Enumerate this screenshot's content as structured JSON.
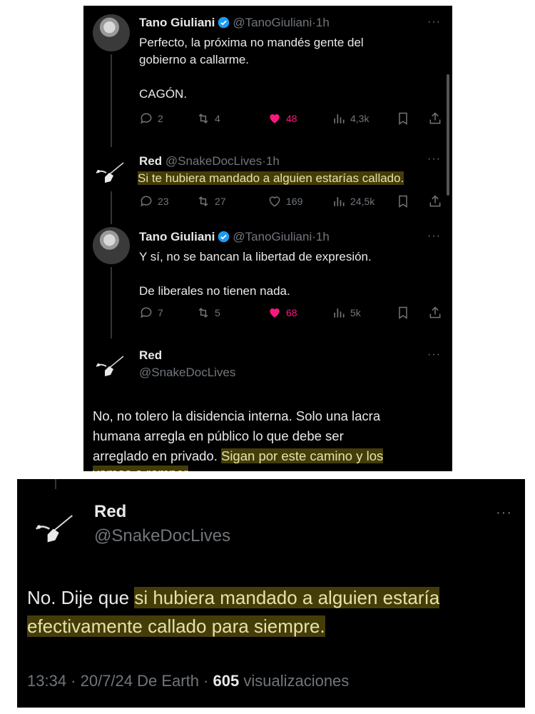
{
  "thread": {
    "tweets": [
      {
        "name": "Tano Giuliani",
        "handle": "@TanoGiuliani",
        "time": "1h",
        "lines": [
          "Perfecto, la próxima no mandés gente del",
          "gobierno a callarme.",
          "",
          "CAGÓN."
        ],
        "replies": "2",
        "retweets": "4",
        "likes": "48",
        "views": "4,3k",
        "liked": true
      },
      {
        "name": "Red",
        "handle": "@SnakeDocLives",
        "time": "1h",
        "lines": [
          "Si te hubiera mandado a alguien estarías callado."
        ],
        "replies": "23",
        "retweets": "27",
        "likes": "169",
        "views": "24,5k",
        "liked": false
      },
      {
        "name": "Tano Giuliani",
        "handle": "@TanoGiuliani",
        "time": "1h",
        "lines": [
          "Y sí, no se bancan la libertad de expresión.",
          "",
          "De liberales no tienen nada."
        ],
        "replies": "7",
        "retweets": "5",
        "likes": "68",
        "views": "5k",
        "liked": true
      }
    ],
    "focused": {
      "name": "Red",
      "handle": "@SnakeDocLives",
      "lines": [
        "No, no tolero la disidencia interna. Solo una lacra",
        "humana arregla en público lo que debe ser"
      ],
      "line3_plain": "arreglado en privado. ",
      "line3_highlight": "Sigan por este camino y los",
      "line4_partial": "vamos a romper"
    }
  },
  "reply": {
    "name": "Red",
    "handle": "@SnakeDocLives",
    "text_plain": "No. Dije que ",
    "text_highlight_1": "si hubiera mandado a alguien estaría",
    "text_highlight_2": "efectivamente callado para siempre.",
    "meta_time": "13:34 · 20/7/24 De Earth · ",
    "meta_views_count": "605",
    "meta_views_label": " visualizaciones"
  },
  "colors": {
    "background": "#000000",
    "text": "#e7e9ea",
    "muted": "#71767b",
    "like": "#f91880",
    "verified": "#1d9bf0",
    "highlight": "#d2be1e"
  }
}
